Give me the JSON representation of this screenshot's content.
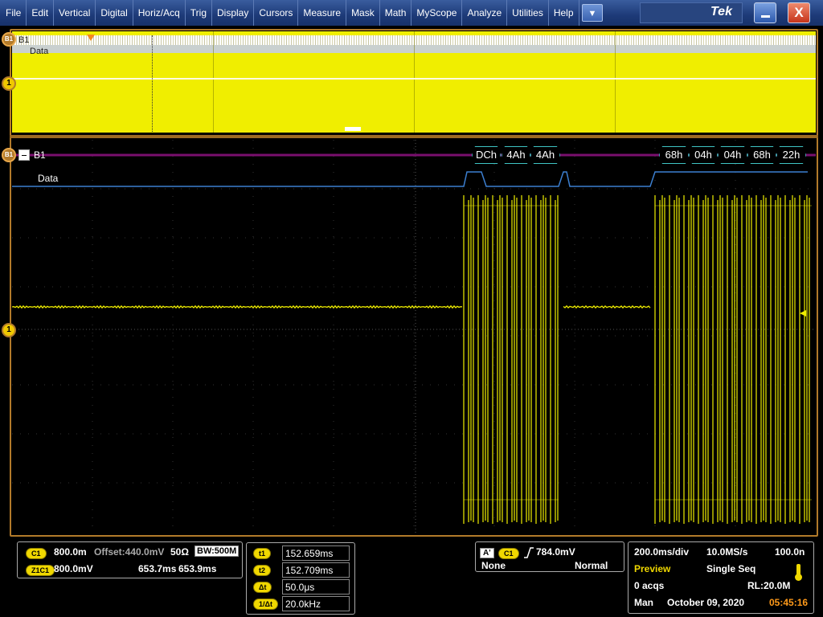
{
  "menu": {
    "items": [
      "File",
      "Edit",
      "Vertical",
      "Digital",
      "Horiz/Acq",
      "Trig",
      "Display",
      "Cursors",
      "Measure",
      "Mask",
      "Math",
      "MyScope",
      "Analyze",
      "Utilities",
      "Help"
    ],
    "dropdown_icon": "chevron-down-icon",
    "brand": "Tek"
  },
  "overview": {
    "bus_label": "B1",
    "data_label": "Data",
    "marker_b1": "B1",
    "marker_ch1": "1"
  },
  "main": {
    "bus_label": "B1",
    "data_label": "Data",
    "marker_b1": "B1",
    "marker_ch1": "1",
    "packets": [
      "DCh",
      "4Ah",
      "4Ah",
      "68h",
      "04h",
      "04h",
      "68h",
      "22h"
    ]
  },
  "channel_panel": {
    "ch_pill": "C1",
    "scale": "800.0m",
    "offset": "Offset:440.0mV",
    "impedance": "50Ω",
    "bw_label": "BW",
    "bw_value": ":500M",
    "zoom_pill": "Z1C1",
    "zoom_scale": "800.0mV",
    "zoom_t1": "653.7ms",
    "zoom_t2": "653.9ms"
  },
  "cursor_panel": {
    "rows": [
      {
        "label": "t1",
        "value": "152.659ms"
      },
      {
        "label": "t2",
        "value": "152.709ms"
      },
      {
        "label": "Δt",
        "value": "50.0μs"
      },
      {
        "label": "1/Δt",
        "value": "20.0kHz"
      }
    ]
  },
  "trigger_panel": {
    "a_label": "A'",
    "ch_pill": "C1",
    "slope_icon": "rising-edge-icon",
    "level": "784.0mV",
    "coupling": "None",
    "mode": "Normal"
  },
  "acq_panel": {
    "timebase": "200.0ms/div",
    "sample_rate": "10.0MS/s",
    "resolution": "100.0n",
    "mode": "Preview",
    "seq": "Single Seq",
    "acqs": "0 acqs",
    "record_length": "RL:20.0M",
    "trigger_mode": "Man",
    "date": "October 09, 2020",
    "time": "05:45:16"
  },
  "colors": {
    "menu_bg": "#1d3a78",
    "channel_yellow": "#f0ee00",
    "bus_purple": "#7a0f6e",
    "data_blue": "#3c7fd0",
    "packet_cyan": "#3fc4c4",
    "frame_orange": "#b27a2a",
    "time_orange": "#ff9a1a"
  }
}
